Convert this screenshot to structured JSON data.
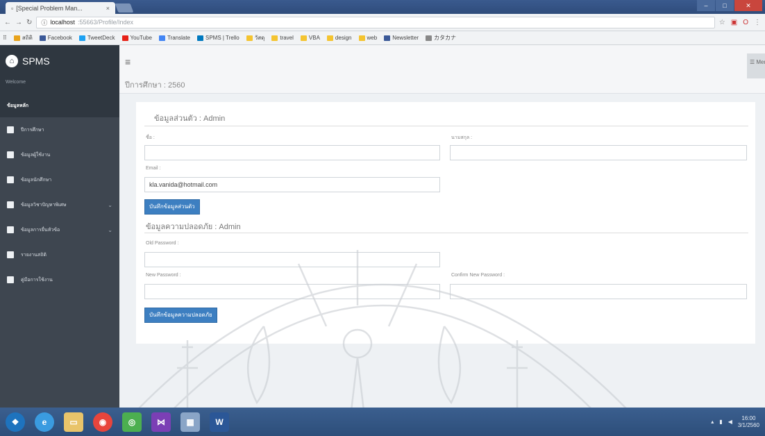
{
  "browser": {
    "tab_title": "[Special Problem Man...",
    "tab_close": "×",
    "url_host": "localhost",
    "url_path": ":55663/Profile/Index",
    "bookmarks": [
      {
        "label": "สถิติ",
        "color": "#e8a31c"
      },
      {
        "label": "Facebook",
        "color": "#3b5998"
      },
      {
        "label": "TweetDeck",
        "color": "#1da1f2"
      },
      {
        "label": "YouTube",
        "color": "#e62117"
      },
      {
        "label": "Translate",
        "color": "#4285f4"
      },
      {
        "label": "SPMS | Trello",
        "color": "#0079bf"
      },
      {
        "label": "วัสดุ",
        "color": "#f4c430"
      },
      {
        "label": "travel",
        "color": "#f4c430"
      },
      {
        "label": "VBA",
        "color": "#f4c430"
      },
      {
        "label": "design",
        "color": "#f4c430"
      },
      {
        "label": "web",
        "color": "#f4c430"
      },
      {
        "label": "Newsletter",
        "color": "#3b5998"
      },
      {
        "label": "カタカナ",
        "color": "#888888"
      }
    ]
  },
  "sidebar": {
    "brand": "SPMS",
    "welcome": "Welcome",
    "section": "ข้อมูลหลัก",
    "items": [
      {
        "label": "ปีการศึกษา",
        "chevron": ""
      },
      {
        "label": "ข้อมูลผู้ใช้งาน",
        "chevron": ""
      },
      {
        "label": "ข้อมูลนักศึกษา",
        "chevron": ""
      },
      {
        "label": "ข้อมูลวิชาปัญหาพิเศษ",
        "chevron": "⌄"
      },
      {
        "label": "ข้อมูลการยื่นหัวข้อ",
        "chevron": "⌄"
      },
      {
        "label": "รายงานสถิติ",
        "chevron": ""
      },
      {
        "label": "คู่มือการใช้งาน",
        "chevron": ""
      }
    ]
  },
  "header": {
    "hamburger": "≡",
    "academic_year": "ปีการศึกษา : 2560",
    "menu_label": "☰ Menu"
  },
  "profile": {
    "title": "ข้อมูลส่วนตัว : Admin",
    "first_name_label": "ชื่อ :",
    "last_name_label": "นามสกุล :",
    "email_label": "Email :",
    "email_value": "kla.vanida@hotmail.com",
    "save_button": "บันทึกข้อมูลส่วนตัว"
  },
  "password": {
    "title": "ข้อมูลความปลอดภัย : Admin",
    "old_label": "Old Password :",
    "new_label": "New Password :",
    "confirm_label": "Confirm New Password :",
    "save_button": "บันทึกข้อมูลความปลอดภัย"
  },
  "taskbar": {
    "apps": [
      {
        "label": "W",
        "color": "#2b5797"
      }
    ],
    "time": "16:00",
    "date": "3/1/2560"
  }
}
